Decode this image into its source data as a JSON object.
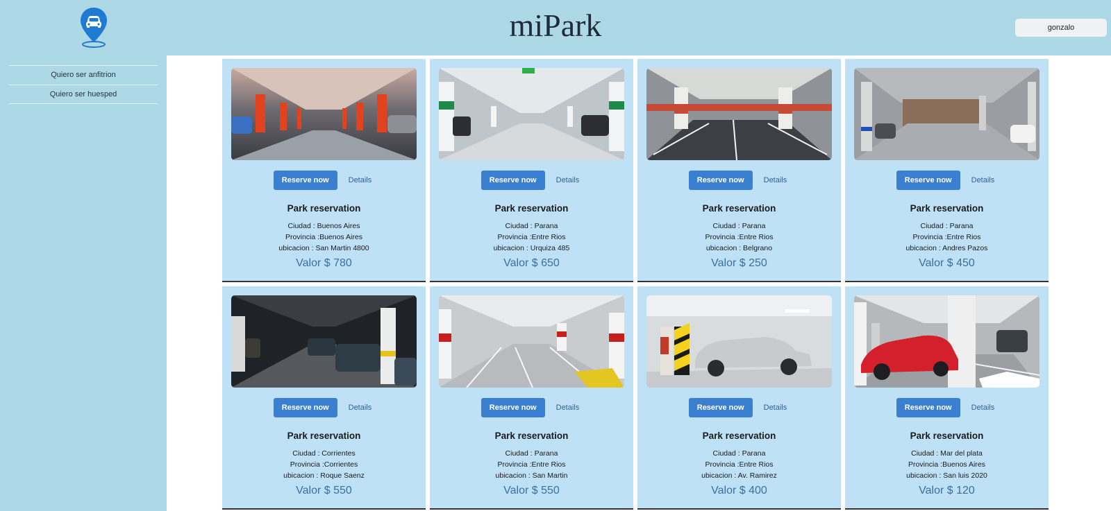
{
  "app": {
    "title": "miPark",
    "user": "gonzalo",
    "brand_color": "#1f7ad1"
  },
  "sidebar": {
    "items": [
      {
        "label": "Quiero ser anfitrion"
      },
      {
        "label": "Quiero ser huesped"
      }
    ]
  },
  "card_labels": {
    "reserve": "Reserve now",
    "details": "Details",
    "title": "Park reservation"
  },
  "cards": [
    {
      "ciudad": "Ciudad : Buenos Aires",
      "provincia": "Provincia :Buenos Aires",
      "ubicacion": "ubicacion : San Martin 4800",
      "valor": "Valor $ 780"
    },
    {
      "ciudad": "Ciudad : Parana",
      "provincia": "Provincia :Entre Rios",
      "ubicacion": "ubicacion : Urquiza 485",
      "valor": "Valor $ 650"
    },
    {
      "ciudad": "Ciudad : Parana",
      "provincia": "Provincia :Entre Rios",
      "ubicacion": "ubicacion : Belgrano",
      "valor": "Valor $ 250"
    },
    {
      "ciudad": "Ciudad : Parana",
      "provincia": "Provincia :Entre Rios",
      "ubicacion": "ubicacion : Andres Pazos",
      "valor": "Valor $ 450"
    },
    {
      "ciudad": "Ciudad : Corrientes",
      "provincia": "Provincia :Corrientes",
      "ubicacion": "ubicacion : Roque Saenz",
      "valor": "Valor $ 550"
    },
    {
      "ciudad": "Ciudad : Parana",
      "provincia": "Provincia :Entre Rios",
      "ubicacion": "ubicacion : San Martin",
      "valor": "Valor $ 550"
    },
    {
      "ciudad": "Ciudad : Parana",
      "provincia": "Provincia :Entre Rios",
      "ubicacion": "ubicacion : Av. Ramirez",
      "valor": "Valor $ 400"
    },
    {
      "ciudad": "Ciudad : Mar del plata",
      "provincia": "Provincia :Buenos Aires",
      "ubicacion": "ubicacion : San luis 2020",
      "valor": "Valor $ 120"
    }
  ]
}
